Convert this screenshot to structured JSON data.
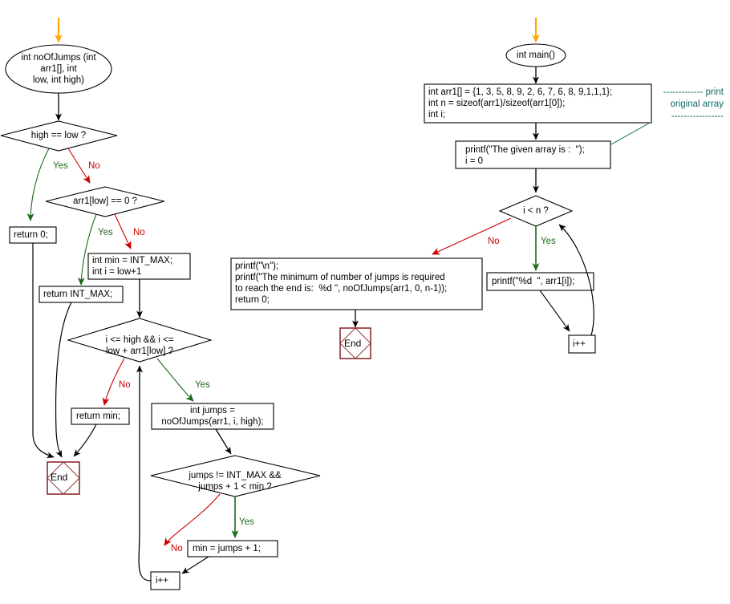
{
  "diagram": {
    "title": "Flowchart: minimum number of jumps to reach the end of an array",
    "colors": {
      "start_arrow": "#FFA500",
      "yes_edge": "#1a6b1a",
      "no_edge": "#cc0000",
      "plain_edge": "#000000",
      "terminator_border": "#8b2d2d",
      "annotation": "#0e6b63",
      "shape_border": "#000000",
      "background": "#ffffff"
    }
  },
  "left_flow": {
    "function_header": "int noOfJumps (int\narr1[], int\nlow, int high)",
    "decision_high_low": "high == low ?",
    "return_zero": "return 0;",
    "decision_arr_zero": "arr1[low] == 0 ?",
    "return_int_max": "return INT_MAX;",
    "init_min_i": "int min = INT_MAX;\nint i = low+1",
    "decision_loop": "i <= high && i <=\nlow + arr1[low] ?",
    "return_min": "return min;",
    "call_jumps": "int jumps =\nnoOfJumps(arr1, i, high);",
    "decision_jumps": "jumps != INT_MAX &&\njumps + 1 < min ?",
    "assign_min": "min = jumps + 1;",
    "increment_i": "i++",
    "end": "End"
  },
  "right_flow": {
    "main_header": "int main()",
    "declarations": "int arr1[] = {1, 3, 5, 8, 9, 2, 6, 7, 6, 8, 9,1,1,1};\nint n = sizeof(arr1)/sizeof(arr1[0]);\nint i;",
    "print_header": "printf(\"The given array is :  \");\ni = 0",
    "decision_i_lt_n": "i < n ?",
    "print_element": "printf(\"%d  \", arr1[i]);",
    "increment_i": "i++",
    "final_output": "printf(\"\\n\");\nprintf(\"The minimum of number of jumps is required\nto reach the end is:  %d \", noOfJumps(arr1, 0, n-1));\nreturn 0;",
    "end": "End",
    "annotation": "------------- print\noriginal array\n-----------------"
  },
  "edge_labels": {
    "yes": "Yes",
    "no": "No"
  }
}
